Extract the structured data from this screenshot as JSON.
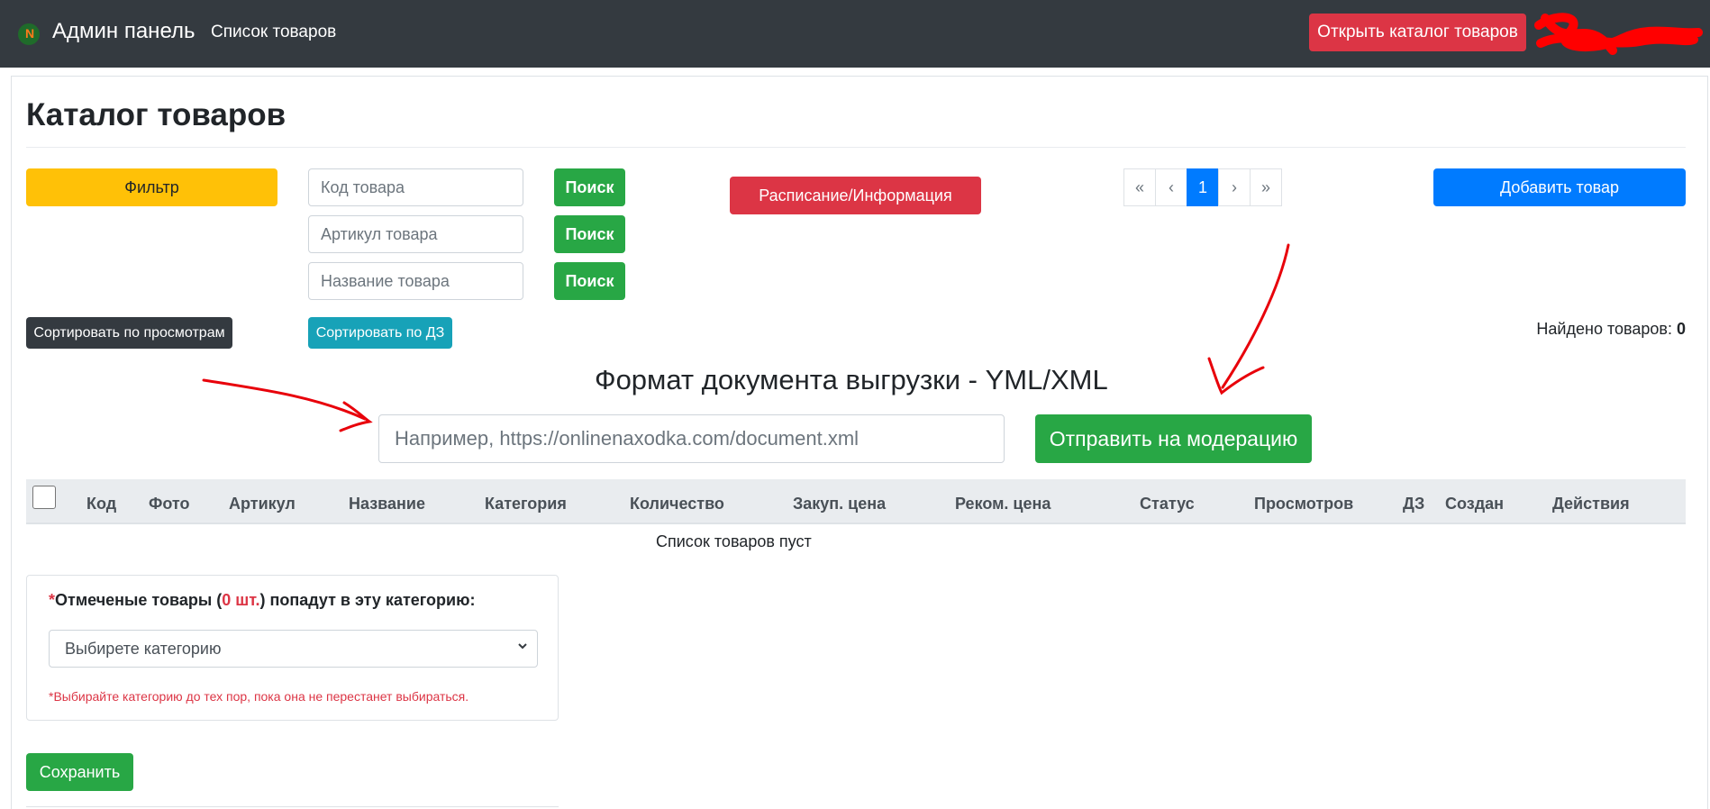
{
  "navbar": {
    "brand_letter": "N",
    "brand_name": "Админ панель",
    "nav_link": "Список товаров",
    "open_catalog_button": "Открыть каталог товаров"
  },
  "page": {
    "title": "Каталог товаров"
  },
  "filters": {
    "filter_button": "Фильтр",
    "code_placeholder": "Код товара",
    "article_placeholder": "Артикул товара",
    "name_placeholder": "Название товара",
    "search_button": "Поиск",
    "schedule_button": "Расписание/Информация",
    "add_product_button": "Добавить товар",
    "sort_views_button": "Сортировать по просмотрам",
    "sort_dz_button": "Сортировать по ДЗ"
  },
  "pagination": {
    "first": "«",
    "prev": "‹",
    "current": "1",
    "next": "›",
    "last": "»"
  },
  "found": {
    "label": "Найдено товаров:",
    "count": "0"
  },
  "upload": {
    "title": "Формат документа выгрузки - YML/XML",
    "placeholder": "Например, https://onlinenaxodka.com/document.xml",
    "submit_button": "Отправить на модерацию"
  },
  "table": {
    "columns": [
      "Код",
      "Фото",
      "Артикул",
      "Название",
      "Категория",
      "Количество",
      "Закуп. цена",
      "Реком. цена",
      "Статус",
      "Просмотров",
      "ДЗ",
      "Создан",
      "Действия"
    ],
    "empty_text": "Список товаров пуст"
  },
  "category_box": {
    "asterisk": "*",
    "label_before": "Отмеченые товары (",
    "count": "0 шт.",
    "label_after": ") попадут в эту категорию:",
    "select_value": "Выбирете категорию",
    "note": "*Выбирайте категорию до тех пор, пока она не перестанет выбираться."
  },
  "save_button": "Сохранить",
  "colors": {
    "navbar": "#343a40",
    "danger": "#dc3545",
    "success": "#28a745",
    "primary": "#007bff",
    "warning": "#ffc107",
    "info": "#17a2b8",
    "dark": "#343a40"
  }
}
